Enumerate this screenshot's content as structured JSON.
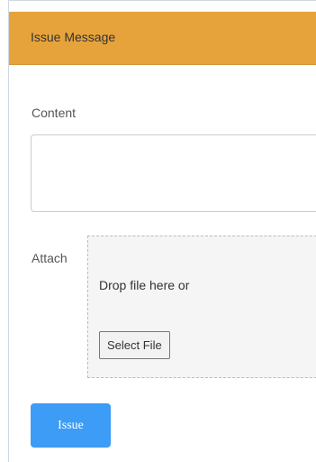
{
  "header": {
    "title": "Issue Message"
  },
  "form": {
    "content_label": "Content",
    "content_value": "",
    "attach_label": "Attach",
    "dropzone_text": "Drop file here or",
    "select_file_label": "Select File",
    "submit_label": "Issue"
  },
  "colors": {
    "header_bg": "#e6a33b",
    "submit_bg": "#3d9cf5"
  }
}
